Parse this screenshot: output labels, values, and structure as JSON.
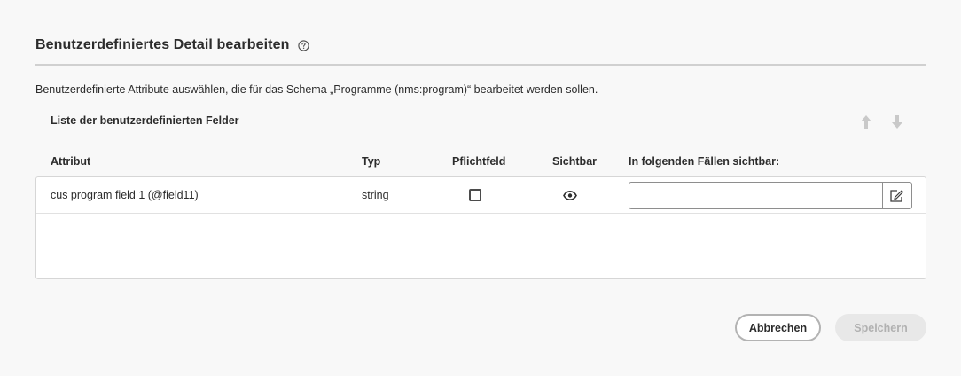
{
  "dialog": {
    "title": "Benutzerdefiniertes Detail bearbeiten",
    "description": "Benutzerdefinierte Attribute auswählen, die für das Schema „Programme (nms:program)“ bearbeitet werden sollen."
  },
  "list": {
    "title": "Liste der benutzerdefinierten Felder",
    "columns": {
      "attribute": "Attribut",
      "type": "Typ",
      "required": "Pflichtfeld",
      "visible": "Sichtbar",
      "visible_if": "In folgenden Fällen sichtbar:"
    },
    "rows": [
      {
        "attribute": "cus program field 1 (@field11)",
        "type": "string",
        "required": false,
        "visible": true,
        "visible_if": ""
      }
    ]
  },
  "footer": {
    "cancel_label": "Abbrechen",
    "save_label": "Speichern"
  },
  "icons": {
    "help": "help-circle-icon",
    "move_up": "arrow-up-icon",
    "move_down": "arrow-down-icon",
    "visible": "eye-icon",
    "edit": "edit-icon"
  },
  "colors": {
    "background": "#f8f8f8",
    "text": "#2c2c2c",
    "disabled_text": "#b1b1b1",
    "disabled_bg": "#e8e8e8"
  }
}
